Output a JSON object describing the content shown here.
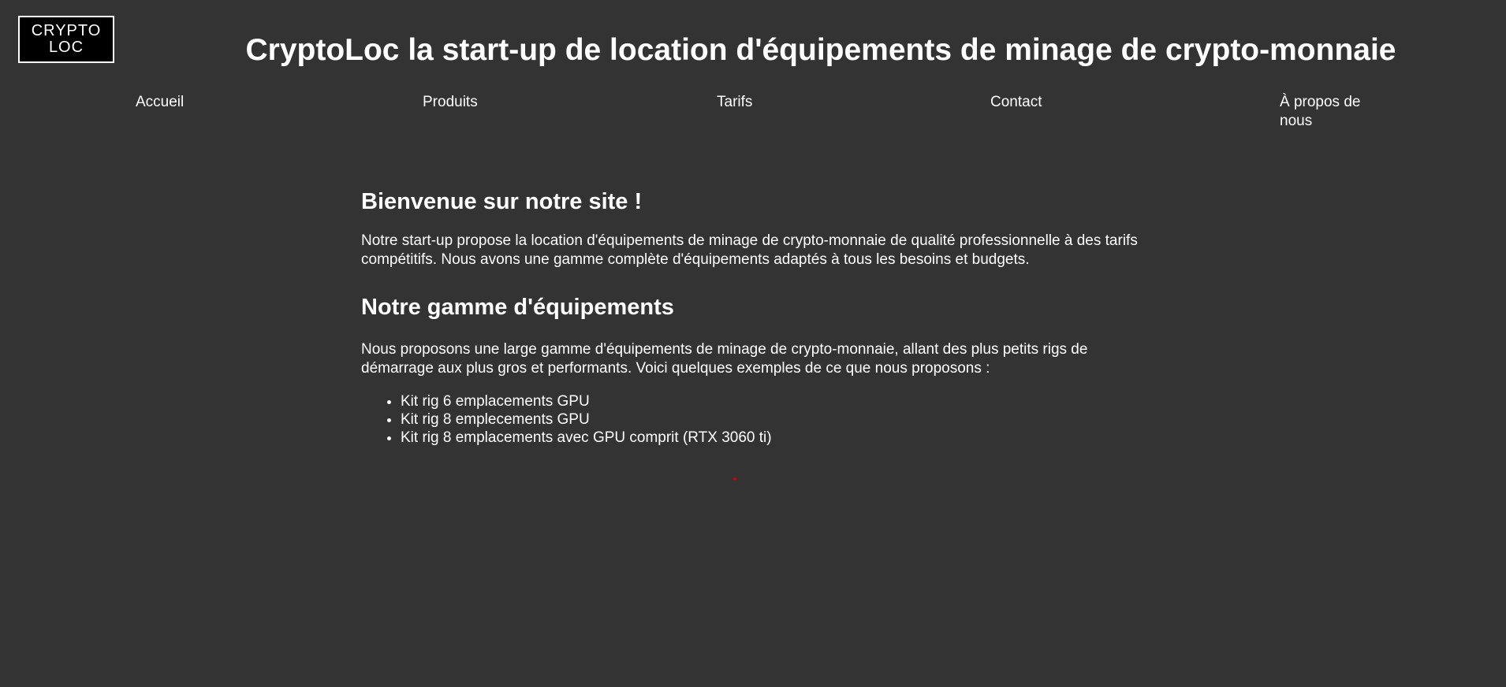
{
  "header": {
    "logo_line1": "CRYPTO",
    "logo_line2": "LOC",
    "title": "CryptoLoc la start-up de location d'équipements de minage de crypto-monnaie"
  },
  "nav": {
    "items": [
      {
        "label": "Accueil"
      },
      {
        "label": "Produits"
      },
      {
        "label": "Tarifs"
      },
      {
        "label": "Contact"
      },
      {
        "label": "À propos de nous"
      }
    ]
  },
  "main": {
    "welcome_heading": "Bienvenue sur notre site !",
    "intro_text": "Notre start-up propose la location d'équipements de minage de crypto-monnaie de qualité professionnelle à des tarifs compétitifs. Nous avons une gamme complète d'équipements adaptés à tous les besoins et budgets.",
    "range_heading": "Notre gamme d'équipements",
    "range_text": "Nous proposons une large gamme d'équipements de minage de crypto-monnaie, allant des plus petits rigs de démarrage aux plus gros et performants. Voici quelques exemples de ce que nous proposons :",
    "products": [
      "Kit rig 6 emplacements GPU",
      "Kit rig 8 emplecements GPU",
      "Kit rig 8 emplacements avec GPU comprit (RTX 3060 ti)"
    ]
  },
  "colors": {
    "background": "#333333",
    "text": "#ffffff",
    "logo_background": "#000000",
    "dot": "#d00000"
  }
}
